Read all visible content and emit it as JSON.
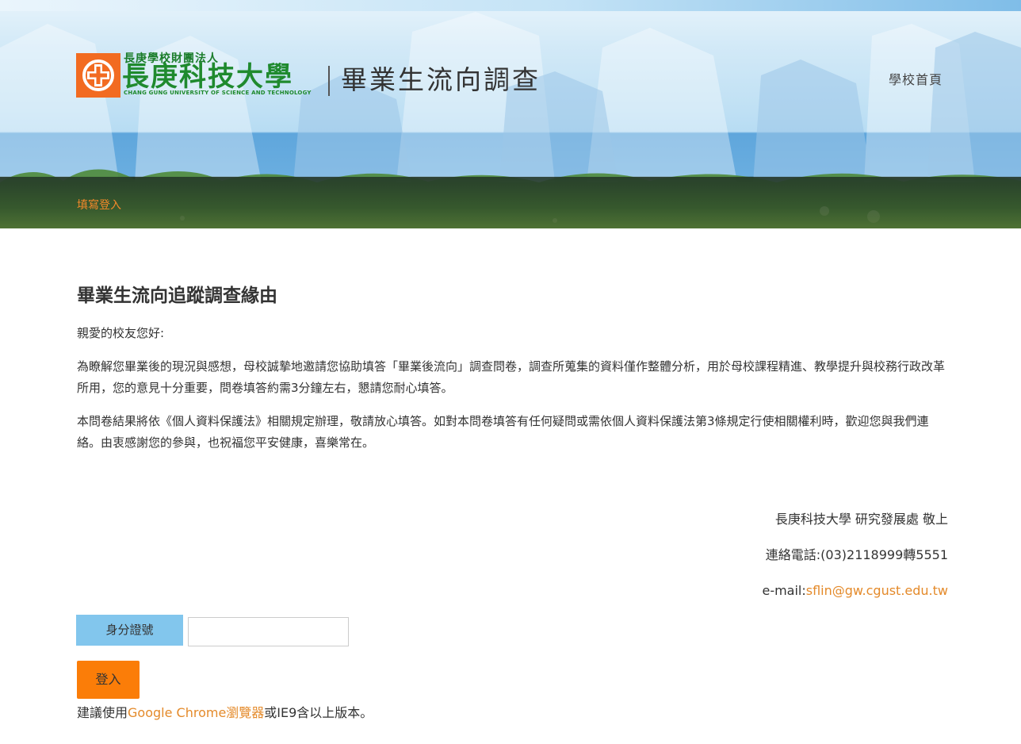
{
  "header": {
    "org_label": "長庚學校財團法人",
    "university_name": "長庚科技大學",
    "university_name_en": "CHANG GUNG UNIVERSITY OF SCIENCE AND TECHNOLOGY",
    "survey_title": "畢業生流向調查",
    "home_link": "學校首頁"
  },
  "breadcrumb": {
    "current": "填寫登入"
  },
  "main": {
    "heading": "畢業生流向追蹤調查緣由",
    "greeting": "親愛的校友您好:",
    "paragraph_1": "為瞭解您畢業後的現況與感想，母校誠摯地邀請您協助填答「畢業後流向」調查問卷，調查所蒐集的資料僅作整體分析，用於母校課程精進、教學提升與校務行政改革所用，您的意見十分重要，問卷填答約需3分鐘左右，懇請您耐心填答。",
    "paragraph_2": "本問卷結果將依《個人資料保護法》相關規定辦理，敬請放心填答。如對本問卷填答有任何疑問或需依個人資料保護法第3條規定行使相關權利時，歡迎您與我們連絡。由衷感謝您的參與，也祝福您平安健康，喜樂常在。"
  },
  "signature": {
    "sender": "長庚科技大學 研究發展處 敬上",
    "phone": "連絡電話:(03)2118999轉5551",
    "email_label": "e-mail:",
    "email": "sflin@gw.cgust.edu.tw"
  },
  "login_form": {
    "id_label": "身分證號",
    "id_value": "",
    "id_placeholder": "",
    "submit_label": "登入"
  },
  "browser_note": {
    "prefix": "建議使用",
    "browser": "Google Chrome瀏覽器",
    "suffix": "或IE9含以上版本。"
  },
  "colors": {
    "accent_orange": "#fb7d08",
    "link_orange": "#e48a2a",
    "label_blue": "#82c6ed",
    "logo_green": "#1f8a2e"
  }
}
